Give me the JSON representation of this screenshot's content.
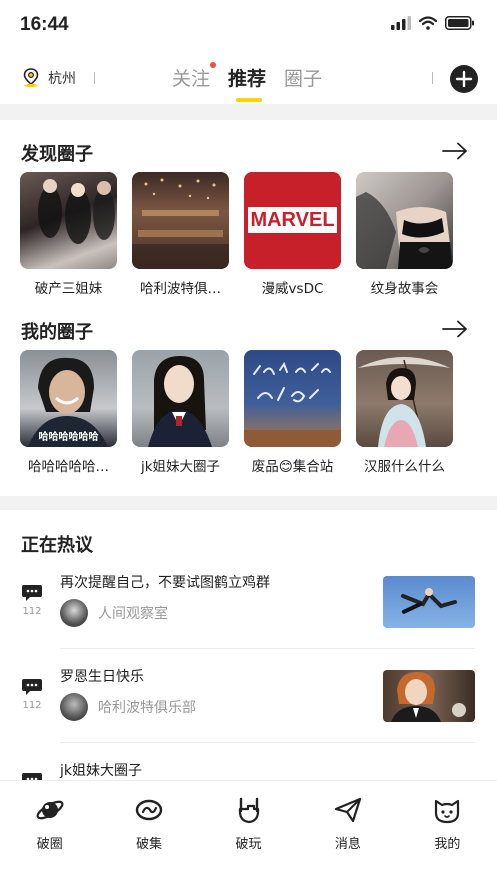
{
  "status": {
    "time": "16:44"
  },
  "nav": {
    "location": "杭州",
    "tabs": [
      {
        "label": "关注",
        "active": false,
        "dot": true
      },
      {
        "label": "推荐",
        "active": true,
        "dot": false
      },
      {
        "label": "圈子",
        "active": false,
        "dot": false
      }
    ]
  },
  "discover": {
    "title": "发现圈子",
    "items": [
      {
        "label": "破产三姐妹"
      },
      {
        "label": "哈利波特俱…"
      },
      {
        "label": "漫威vsDC",
        "thumb_text": "MARVEL"
      },
      {
        "label": "纹身故事会"
      }
    ]
  },
  "my_circles": {
    "title": "我的圈子",
    "items": [
      {
        "label": "哈哈哈哈哈…",
        "thumb_caption": "哈哈哈哈哈哈"
      },
      {
        "label": "jk姐妹大圈子"
      },
      {
        "label": "废品😊集合站"
      },
      {
        "label": "汉服什么什么"
      }
    ]
  },
  "hot": {
    "title": "正在热议",
    "items": [
      {
        "title": "再次提醒自己，不要试图鹤立鸡群",
        "author": "人间观察室",
        "count": "112"
      },
      {
        "title": "罗恩生日快乐",
        "author": "哈利波特俱乐部",
        "count": "112"
      },
      {
        "title": "jk姐妹大圈子",
        "author": "",
        "count": ""
      }
    ]
  },
  "tabbar": {
    "items": [
      {
        "label": "破圈",
        "icon": "planet-icon"
      },
      {
        "label": "破集",
        "icon": "ring-icon"
      },
      {
        "label": "破玩",
        "icon": "rock-hand-icon"
      },
      {
        "label": "消息",
        "icon": "paper-plane-icon"
      },
      {
        "label": "我的",
        "icon": "cat-face-icon"
      }
    ]
  },
  "colors": {
    "accent": "#ffd200",
    "badge": "#f04a4a",
    "text": "#222222",
    "muted": "#999999"
  }
}
